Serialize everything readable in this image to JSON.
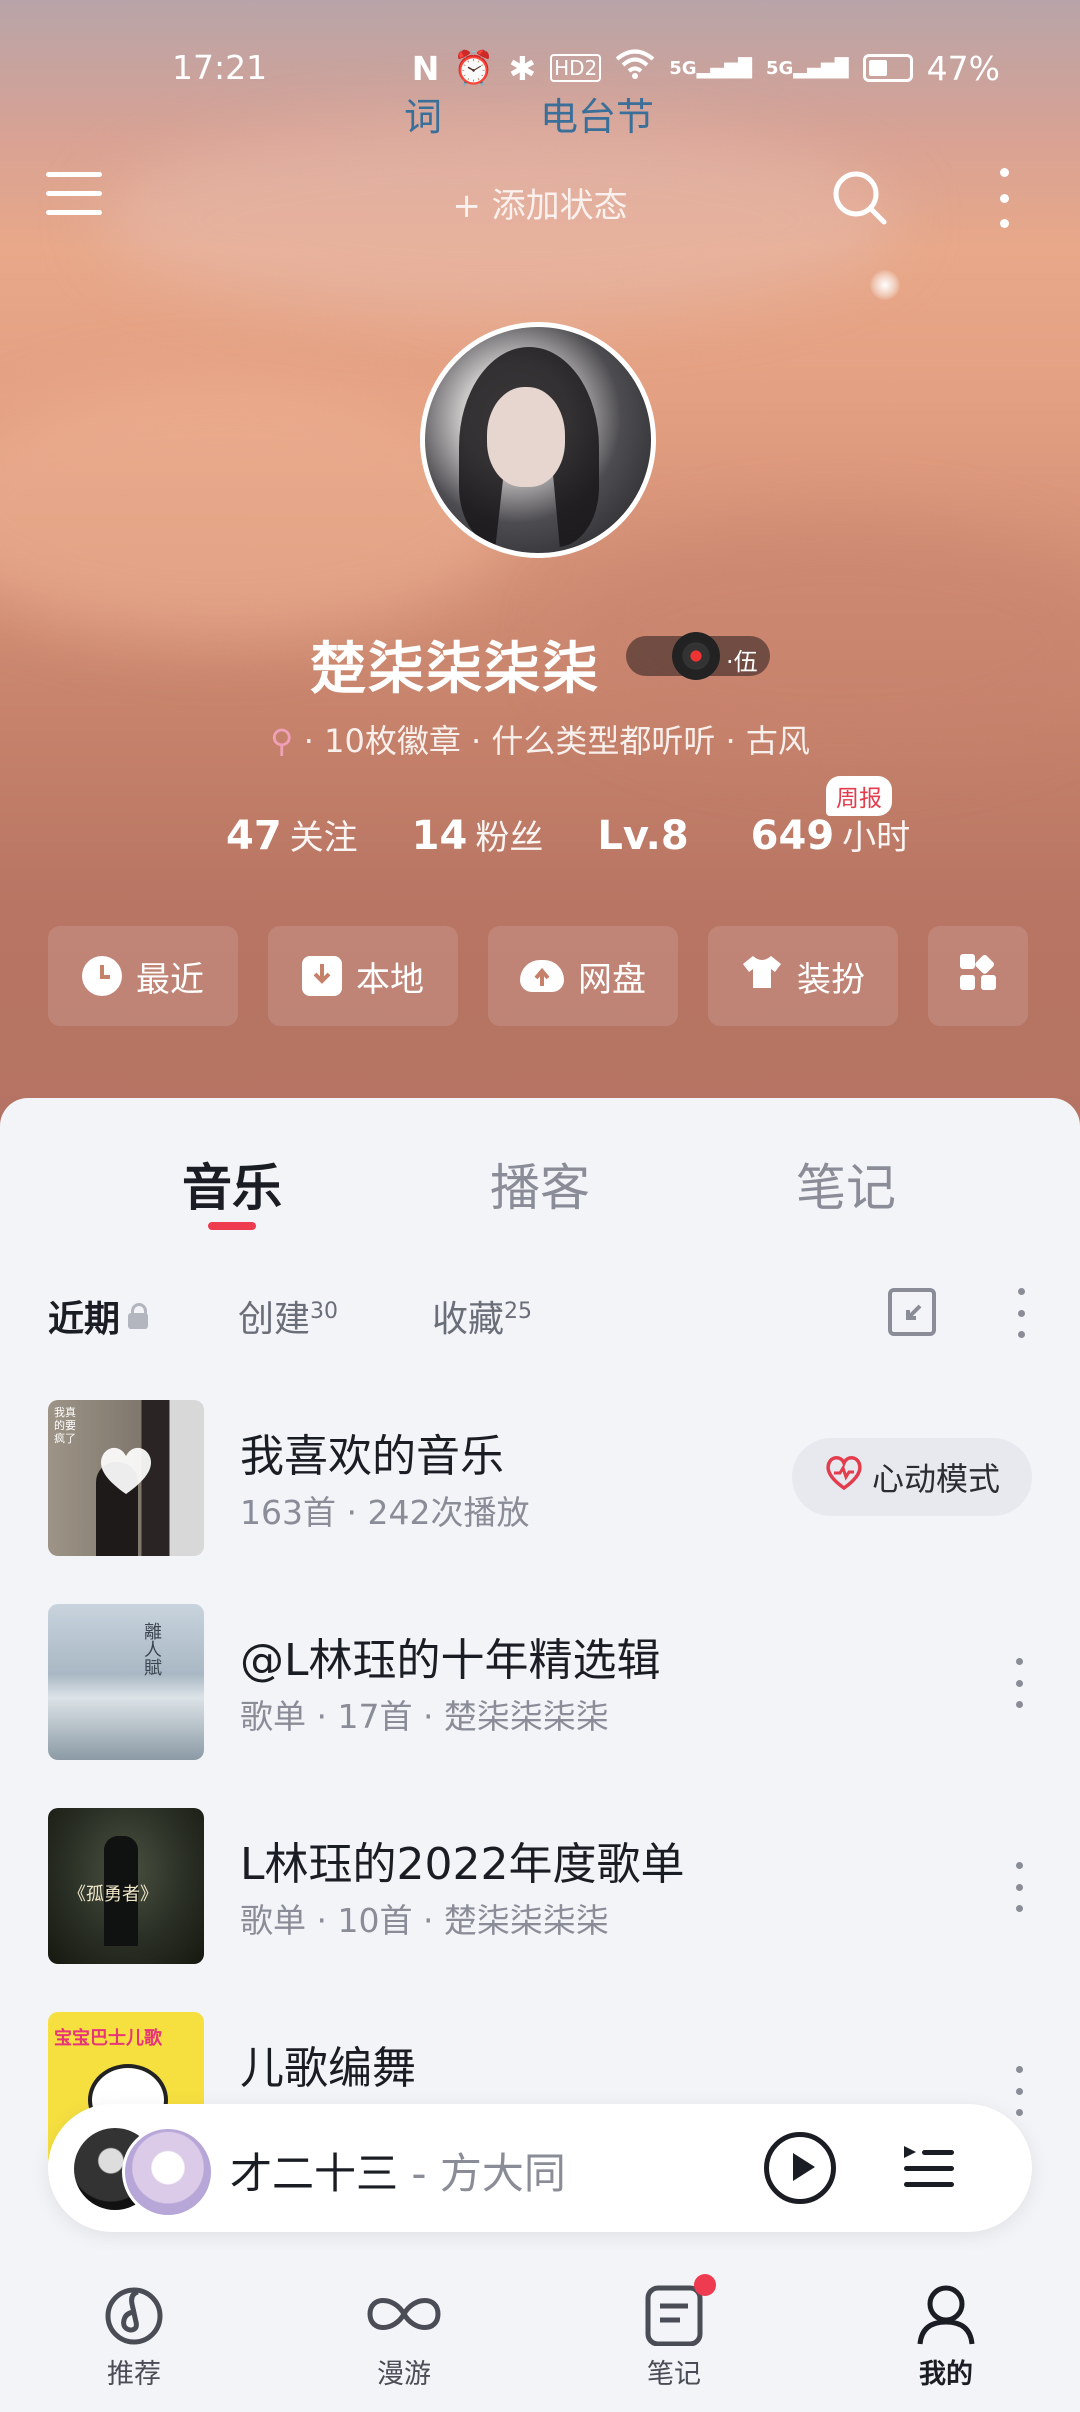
{
  "status_bar": {
    "time": "17:21",
    "battery": "47%",
    "net1": "5G",
    "net2": "5G",
    "hd": "HD2"
  },
  "lyric_ticker": {
    "left": "词",
    "right": "电台节"
  },
  "header": {
    "add_status": "+ 添加状态",
    "menu_icon": "menu-icon",
    "search_icon": "search-icon",
    "more_icon": "more-vertical-icon"
  },
  "profile": {
    "username": "楚柒柒柒柒",
    "vip_level": "·伍",
    "meta": "· 10枚徽章 · 什么类型都听听 · 古风",
    "stats": [
      {
        "num": "47",
        "label": "关注"
      },
      {
        "num": "14",
        "label": "粉丝"
      },
      {
        "num": "Lv.8",
        "label": ""
      },
      {
        "num": "649",
        "label": "小时"
      }
    ],
    "weekly_badge": "周报"
  },
  "quick_actions": [
    {
      "label": "最近",
      "icon": "clock-icon"
    },
    {
      "label": "本地",
      "icon": "download-icon"
    },
    {
      "label": "网盘",
      "icon": "cloud-upload-icon"
    },
    {
      "label": "装扮",
      "icon": "shirt-icon"
    },
    {
      "label": "",
      "icon": "apps-grid-icon"
    }
  ],
  "tabs": [
    "音乐",
    "播客",
    "笔记"
  ],
  "subtabs": [
    {
      "label": "近期",
      "count": ""
    },
    {
      "label": "创建",
      "count": "30"
    },
    {
      "label": "收藏",
      "count": "25"
    }
  ],
  "playlists": [
    {
      "title": "我喜欢的音乐",
      "sub": "163首 · 242次播放",
      "action": "心动模式"
    },
    {
      "title": "@L林珏的十年精选辑",
      "sub": "歌单 · 17首 · 楚柒柒柒柒"
    },
    {
      "title": "L林珏的2022年度歌单",
      "sub": "歌单 · 10首 · 楚柒柒柒柒"
    },
    {
      "title": "儿歌编舞",
      "sub": ""
    }
  ],
  "cover_texts": {
    "c1": "我真的要疯了",
    "c2": "離人賦",
    "c3": "《孤勇者》",
    "c4": "宝宝巴士儿歌"
  },
  "now_playing": {
    "song": "才二十三",
    "artist": " - 方大同"
  },
  "bottom_nav": [
    {
      "label": "推荐",
      "icon": "netease-logo-icon"
    },
    {
      "label": "漫游",
      "icon": "infinity-icon"
    },
    {
      "label": "笔记",
      "icon": "note-icon"
    },
    {
      "label": "我的",
      "icon": "user-icon"
    }
  ],
  "colors": {
    "accent": "#ee3b4f",
    "text": "#1b1d24",
    "muted": "#8a8d97",
    "background": "#f3f4f8"
  }
}
